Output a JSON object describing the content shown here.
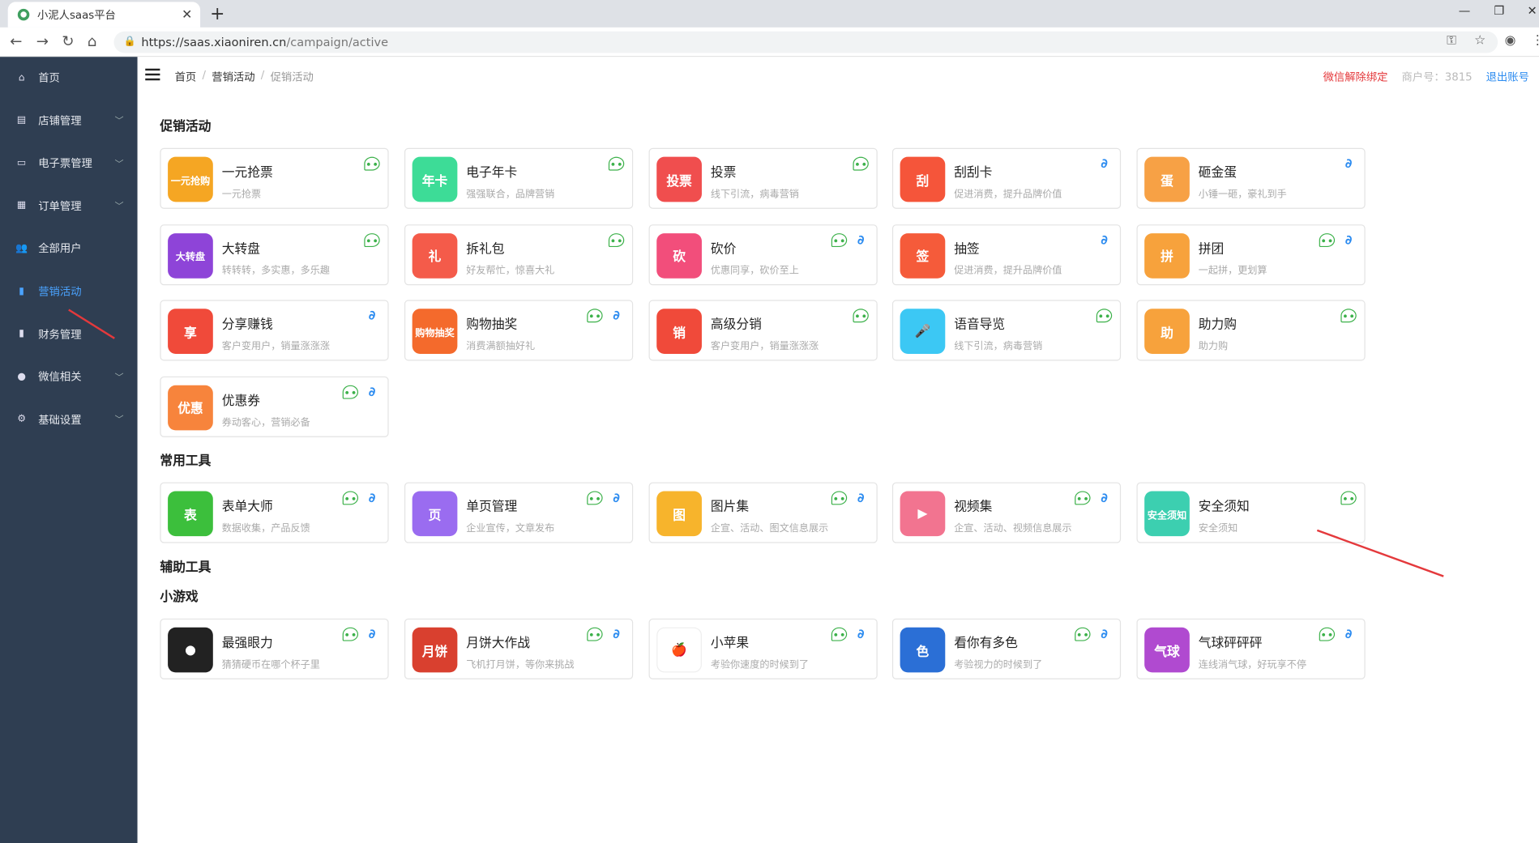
{
  "browser": {
    "tab_title": "小泥人saas平台",
    "url_host": "https://saas.xiaoniren.cn",
    "url_path": "/campaign/active"
  },
  "sidebar": {
    "items": [
      {
        "label": "首页",
        "icon": "home-icon",
        "arrow": false,
        "active": false
      },
      {
        "label": "店铺管理",
        "icon": "shop-icon",
        "arrow": true,
        "active": false
      },
      {
        "label": "电子票管理",
        "icon": "ticket-icon",
        "arrow": true,
        "active": false
      },
      {
        "label": "订单管理",
        "icon": "order-icon",
        "arrow": true,
        "active": false
      },
      {
        "label": "全部用户",
        "icon": "users-icon",
        "arrow": false,
        "active": false
      },
      {
        "label": "营销活动",
        "icon": "chart-icon",
        "arrow": false,
        "active": true
      },
      {
        "label": "财务管理",
        "icon": "finance-icon",
        "arrow": false,
        "active": false
      },
      {
        "label": "微信相关",
        "icon": "wechat-icon",
        "arrow": true,
        "active": false
      },
      {
        "label": "基础设置",
        "icon": "gear-icon",
        "arrow": true,
        "active": false
      }
    ]
  },
  "header": {
    "breadcrumb": [
      "首页",
      "营销活动",
      "促销活动"
    ],
    "unbind": "微信解除绑定",
    "merchant": "商户号：3815",
    "logout": "退出账号"
  },
  "sections": [
    {
      "title": "促销活动",
      "cards": [
        {
          "title": "一元抢票",
          "desc": "一元抢票",
          "icon": "一元抢购",
          "color": "#f5a623",
          "wx": true,
          "link": false
        },
        {
          "title": "电子年卡",
          "desc": "强强联合，品牌营销",
          "icon": "年卡",
          "color": "#3ddc97",
          "wx": true,
          "link": false
        },
        {
          "title": "投票",
          "desc": "线下引流，病毒营销",
          "icon": "投票",
          "color": "#f04e4e",
          "wx": true,
          "link": false
        },
        {
          "title": "刮刮卡",
          "desc": "促进消费，提升品牌价值",
          "icon": "刮",
          "color": "#f5553a",
          "wx": false,
          "link": true
        },
        {
          "title": "砸金蛋",
          "desc": "小锤一砸，豪礼到手",
          "icon": "蛋",
          "color": "#f7a145",
          "wx": false,
          "link": true
        },
        {
          "title": "大转盘",
          "desc": "转转转，多实惠，多乐趣",
          "icon": "大转盘",
          "color": "#8e44d8",
          "wx": true,
          "link": false
        },
        {
          "title": "拆礼包",
          "desc": "好友帮忙，惊喜大礼",
          "icon": "礼",
          "color": "#f45b4a",
          "wx": true,
          "link": false
        },
        {
          "title": "砍价",
          "desc": "优惠同享，砍价至上",
          "icon": "砍",
          "color": "#f24e7b",
          "wx": true,
          "link": true
        },
        {
          "title": "抽签",
          "desc": "促进消费，提升品牌价值",
          "icon": "签",
          "color": "#f55b3a",
          "wx": false,
          "link": true
        },
        {
          "title": "拼团",
          "desc": "一起拼，更划算",
          "icon": "拼",
          "color": "#f7a23c",
          "wx": true,
          "link": true
        },
        {
          "title": "分享赚钱",
          "desc": "客户变用户，销量涨涨涨",
          "icon": "享",
          "color": "#f04a3a",
          "wx": false,
          "link": true
        },
        {
          "title": "购物抽奖",
          "desc": "消费满额抽好礼",
          "icon": "购物抽奖",
          "color": "#f46a2c",
          "wx": true,
          "link": true
        },
        {
          "title": "高级分销",
          "desc": "客户变用户，销量涨涨涨",
          "icon": "销",
          "color": "#f04a3a",
          "wx": true,
          "link": false
        },
        {
          "title": "语音导览",
          "desc": "线下引流，病毒营销",
          "icon": "🎤",
          "color": "#3cc8f4",
          "wx": true,
          "link": false
        },
        {
          "title": "助力购",
          "desc": "助力购",
          "icon": "助",
          "color": "#f7a23c",
          "wx": true,
          "link": false
        },
        {
          "title": "优惠券",
          "desc": "券动客心，营销必备",
          "icon": "优惠",
          "color": "#f7843c",
          "wx": true,
          "link": true
        }
      ]
    },
    {
      "title": "常用工具",
      "cards": [
        {
          "title": "表单大师",
          "desc": "数据收集，产品反馈",
          "icon": "表",
          "color": "#3cbf3c",
          "wx": true,
          "link": true
        },
        {
          "title": "单页管理",
          "desc": "企业宣传，文章发布",
          "icon": "页",
          "color": "#9a6cf0",
          "wx": true,
          "link": true
        },
        {
          "title": "图片集",
          "desc": "企宣、活动、图文信息展示",
          "icon": "图",
          "color": "#f7b42c",
          "wx": true,
          "link": true
        },
        {
          "title": "视频集",
          "desc": "企宣、活动、视频信息展示",
          "icon": "▶",
          "color": "#f27490",
          "wx": true,
          "link": true
        },
        {
          "title": "安全须知",
          "desc": "安全须知",
          "icon": "安全须知",
          "color": "#3ccfb0",
          "wx": true,
          "link": false
        }
      ]
    },
    {
      "title": "辅助工具",
      "cards": []
    },
    {
      "title": "小游戏",
      "cards": [
        {
          "title": "最强眼力",
          "desc": "猜猜硬币在哪个杯子里",
          "icon": "●",
          "color": "#222222",
          "wx": true,
          "link": true
        },
        {
          "title": "月饼大作战",
          "desc": "飞机打月饼，等你来挑战",
          "icon": "月饼",
          "color": "#d9402f",
          "wx": true,
          "link": true
        },
        {
          "title": "小苹果",
          "desc": "考验你速度的时候到了",
          "icon": "🍎",
          "color": "#ffffff",
          "wx": true,
          "link": true
        },
        {
          "title": "看你有多色",
          "desc": "考验视力的时候到了",
          "icon": "色",
          "color": "#2b6fd6",
          "wx": true,
          "link": true
        },
        {
          "title": "气球砰砰砰",
          "desc": "连线消气球，好玩享不停",
          "icon": "气球",
          "color": "#b04ad0",
          "wx": true,
          "link": true
        }
      ]
    }
  ]
}
